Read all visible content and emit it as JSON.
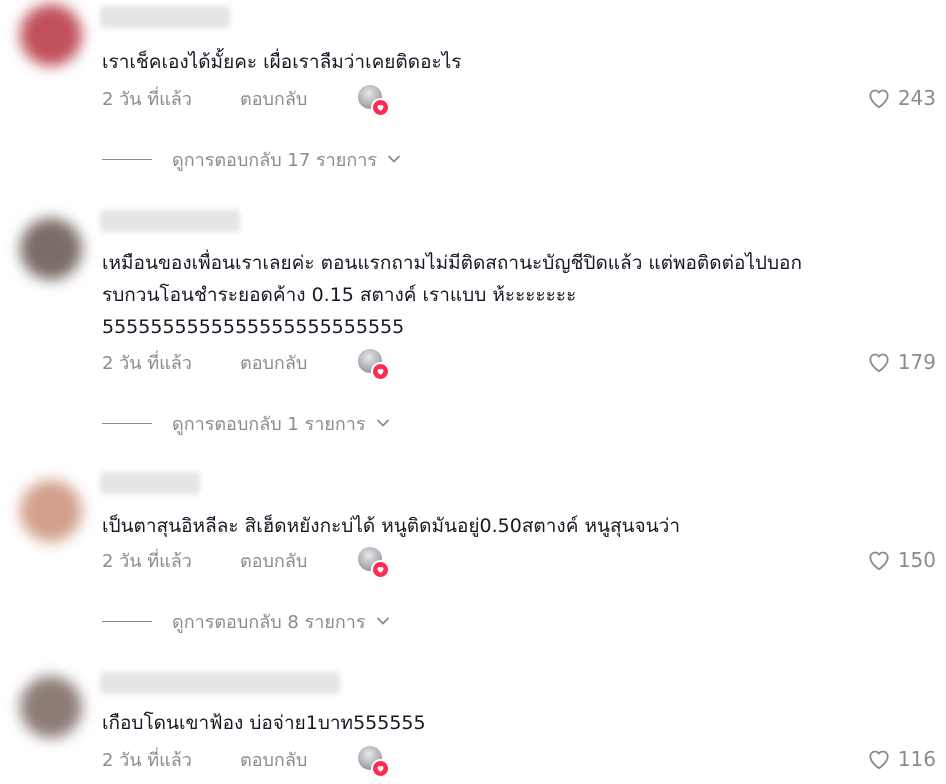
{
  "comments": [
    {
      "text": "เราเช็คเองได้มั้ยคะ เผื่อเราลืมว่าเคยติดอะไร",
      "time": "2 วัน ที่แล้ว",
      "reply_label": "ตอบกลับ",
      "likes": "243",
      "view_replies": "ดูการตอบกลับ 17 รายการ",
      "avatar_color": "#c0505a"
    },
    {
      "text": "เหมือนของเพื่อนเราเลยค่ะ ตอนแรกถามไม่มีติดสถานะบัญชีปิดแล้ว แต่พอติดต่อไปบอก\nรบกวนโอนชำระยอดค้าง 0.15 สตางค์ เราแบบ ห้ะะะะะะะ\n5555555555555555555555555",
      "time": "2 วัน ที่แล้ว",
      "reply_label": "ตอบกลับ",
      "likes": "179",
      "view_replies": "ดูการตอบกลับ 1 รายการ",
      "avatar_color": "#7a6c66"
    },
    {
      "text": "เป็นตาสุนอิหลีละ สิเฮ็ดหยังกะบ่ได้ หนูติดมันอยู่0.50สตางค์ หนูสุนจนว่า",
      "time": "2 วัน ที่แล้ว",
      "reply_label": "ตอบกลับ",
      "likes": "150",
      "view_replies": "ดูการตอบกลับ 8 รายการ",
      "avatar_color": "#d2a08c"
    },
    {
      "text": "เกือบโดนเขาฟ้อง บ่อจ่าย1บาท555555",
      "time": "2 วัน ที่แล้ว",
      "reply_label": "ตอบกลับ",
      "likes": "116",
      "avatar_color": "#8c7c76"
    }
  ]
}
